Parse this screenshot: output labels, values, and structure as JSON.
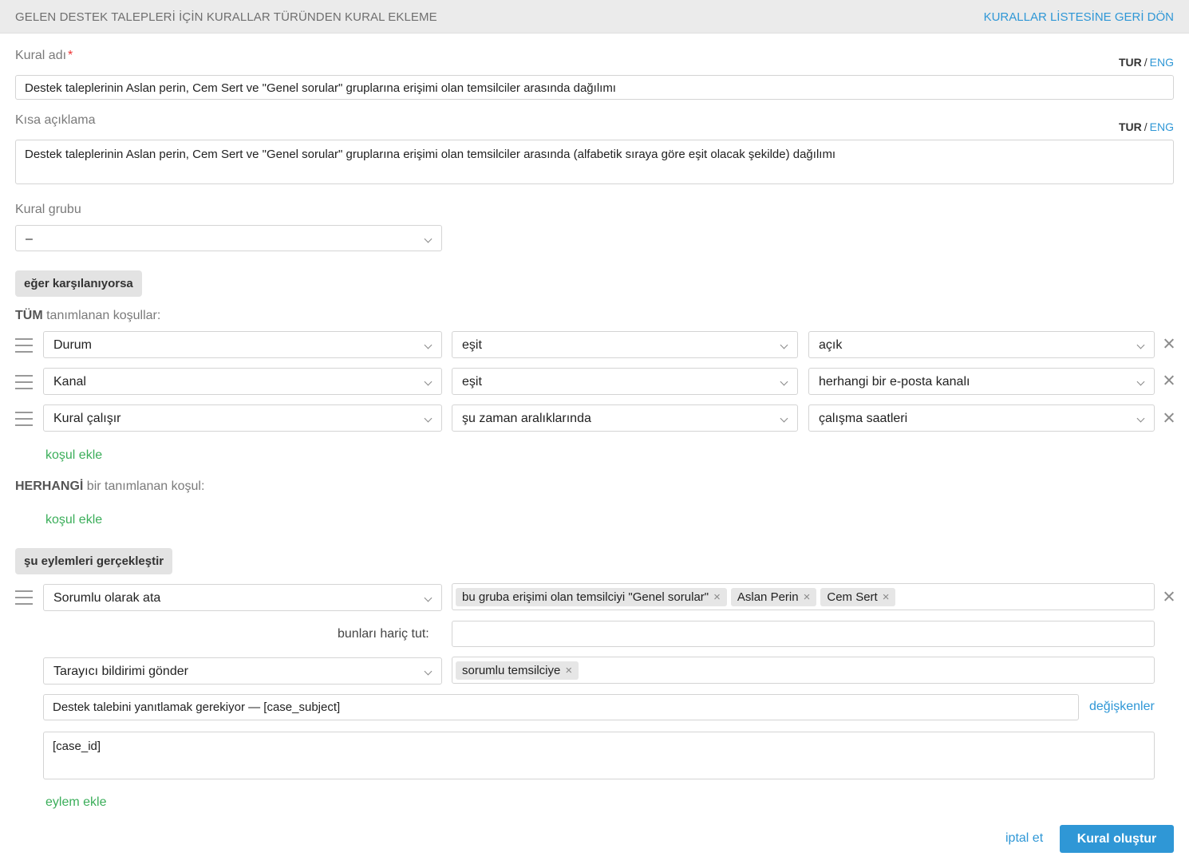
{
  "header": {
    "title": "GELEN DESTEK TALEPLERİ İÇİN KURALLAR TÜRÜNDEN KURAL EKLEME",
    "back_link": "KURALLAR LİSTESİNE GERİ DÖN"
  },
  "lang": {
    "tur": "TUR",
    "separator": "/",
    "eng": "ENG"
  },
  "rule_name": {
    "label": "Kural adı",
    "required_mark": "*",
    "value": "Destek taleplerinin Aslan perin, Cem Sert ve \"Genel sorular\" gruplarına erişimi olan temsilciler arasında dağılımı"
  },
  "short_desc": {
    "label": "Kısa açıklama",
    "value": "Destek taleplerinin Aslan perin, Cem Sert ve \"Genel sorular\" gruplarına erişimi olan temsilciler arasında (alfabetik sıraya göre eşit olacak şekilde) dağılımı"
  },
  "rule_group": {
    "label": "Kural grubu",
    "value": "–"
  },
  "if_section": {
    "tag": "eğer karşılanıyorsa"
  },
  "all_conditions": {
    "bold": "TÜM",
    "rest": "tanımlanan koşullar:",
    "rows": [
      {
        "field": "Durum",
        "operator": "eşit",
        "value": "açık"
      },
      {
        "field": "Kanal",
        "operator": "eşit",
        "value": "herhangi bir e-posta kanalı"
      },
      {
        "field": "Kural çalışır",
        "operator": "şu zaman aralıklarında",
        "value": "çalışma saatleri"
      }
    ],
    "add_link": "koşul ekle"
  },
  "any_conditions": {
    "bold": "HERHANGİ",
    "rest": "bir tanımlanan koşul:",
    "add_link": "koşul ekle"
  },
  "actions_section": {
    "tag": "şu eylemleri gerçekleştir"
  },
  "actions": {
    "assign": {
      "action": "Sorumlu olarak ata",
      "chips": [
        "bu gruba erişimi olan temsilciyi \"Genel sorular\"",
        "Aslan Perin",
        "Cem Sert"
      ],
      "exclude_label": "bunları hariç tut:",
      "exclude_value": ""
    },
    "notify": {
      "action": "Tarayıcı bildirimi gönder",
      "chips": [
        "sorumlu temsilciye"
      ],
      "subject": "Destek talebini yanıtlamak gerekiyor — [case_subject]",
      "variables_link": "değişkenler",
      "body": "[case_id]"
    },
    "chip_remove": "×",
    "add_link": "eylem ekle"
  },
  "footer": {
    "cancel": "iptal et",
    "submit": "Kural oluştur"
  }
}
